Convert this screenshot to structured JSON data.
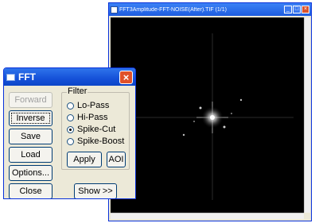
{
  "image_window": {
    "title": "FFT3Amplitude-FFT-NOISE(After).TIF (1/1)",
    "minimize": "_",
    "maximize": "□",
    "close": "×"
  },
  "dialog": {
    "title": "FFT",
    "close": "×",
    "buttons": {
      "forward": "Forward",
      "inverse": "Inverse",
      "save": "Save",
      "load": "Load",
      "options": "Options...",
      "close": "Close",
      "show": "Show >>",
      "apply": "Apply",
      "aoi": "AOI"
    },
    "filter": {
      "label": "Filter",
      "options": [
        "Lo-Pass",
        "Hi-Pass",
        "Spike-Cut",
        "Spike-Boost"
      ],
      "selected": "Spike-Cut"
    }
  }
}
